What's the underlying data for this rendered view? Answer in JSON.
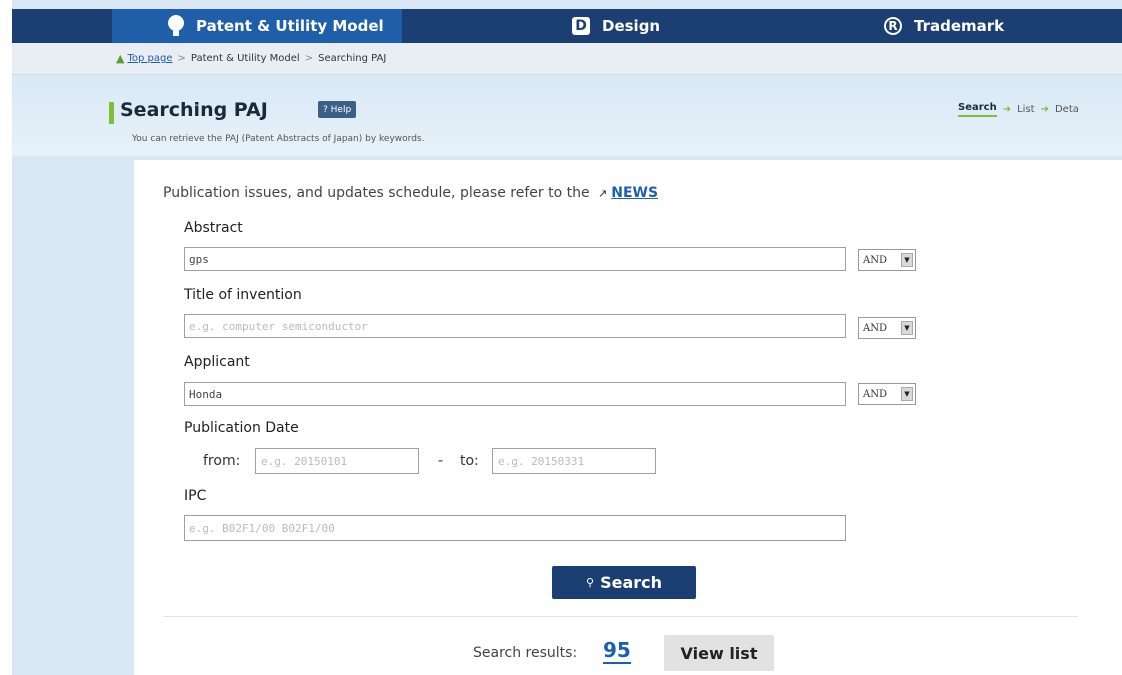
{
  "nav": {
    "tabs": [
      {
        "label": "Patent & Utility Model",
        "icon": "lightbulb-icon",
        "active": true
      },
      {
        "label": "Design",
        "icon": "design-d-icon",
        "active": false
      },
      {
        "label": "Trademark",
        "icon": "registered-r-icon",
        "active": false
      }
    ],
    "design_icon_glyph": "D",
    "trademark_icon_glyph": "R"
  },
  "breadcrumb": {
    "home": "Top page",
    "separator": ">",
    "level1": "Patent & Utility Model",
    "level2": "Searching PAJ"
  },
  "header": {
    "title": "Searching PAJ",
    "help": "? Help",
    "subtitle": "You can retrieve the PAJ (Patent Abstracts of Japan) by keywords.",
    "steps": [
      "Search",
      "List",
      "Deta"
    ]
  },
  "notice": {
    "text": "Publication issues, and updates schedule, please refer to the",
    "link": "NEWS"
  },
  "form": {
    "abstract": {
      "label": "Abstract",
      "value": "gps",
      "placeholder": "",
      "operator": "AND"
    },
    "title": {
      "label": "Title of invention",
      "value": "",
      "placeholder": "e.g. computer semiconductor",
      "operator": "AND"
    },
    "applicant": {
      "label": "Applicant",
      "value": "Honda",
      "placeholder": "",
      "operator": "AND"
    },
    "pubdate": {
      "label": "Publication Date",
      "from_label": "from:",
      "from_placeholder": "e.g. 20150101",
      "dash": "-",
      "to_label": "to:",
      "to_placeholder": "e.g. 20150331"
    },
    "ipc": {
      "label": "IPC",
      "value": "",
      "placeholder": "e.g. B02F1/00 B02F1/00"
    }
  },
  "search_button": "Search",
  "results": {
    "label": "Search results:",
    "count": "95",
    "view_list": "View list"
  },
  "colors": {
    "nav_bg": "#1b3f73",
    "nav_active": "#1f5fa9",
    "accent_green": "#7ebf3a",
    "link_blue": "#1a5fb4"
  }
}
